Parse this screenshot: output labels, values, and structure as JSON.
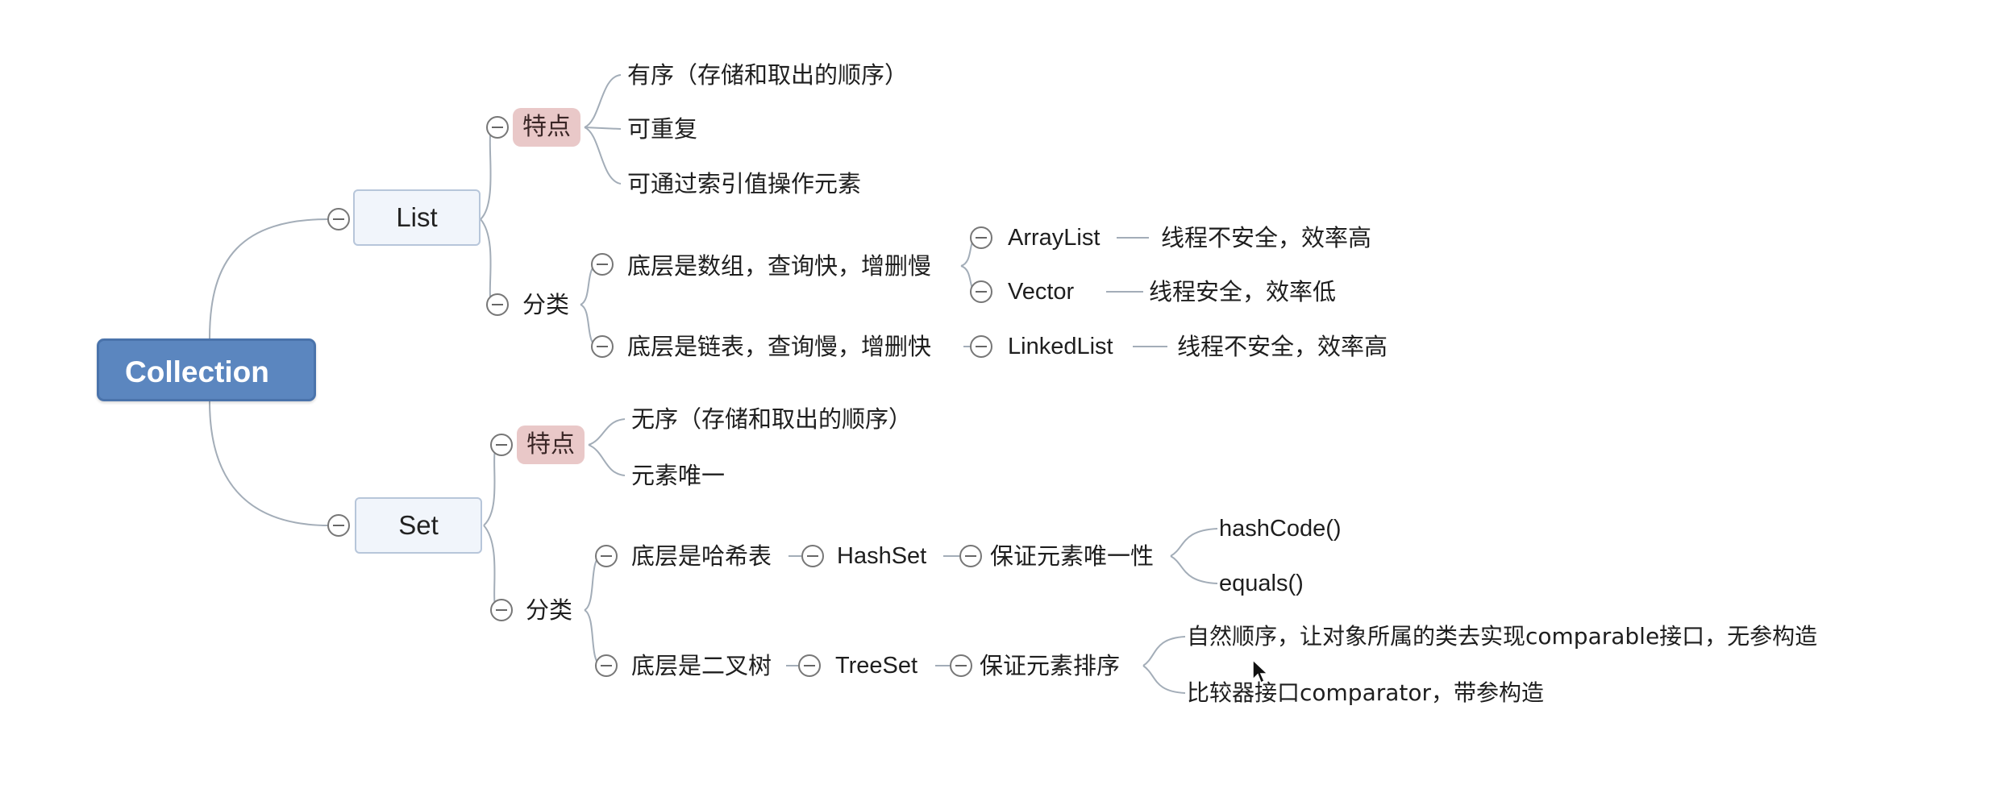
{
  "root": {
    "label": "Collection"
  },
  "list": {
    "label": "List",
    "features_label": "特点",
    "features": [
      "有序（存储和取出的顺序）",
      "可重复",
      "可通过索引值操作元素"
    ],
    "category_label": "分类",
    "array_based": {
      "label": "底层是数组，查询快，增删慢",
      "array_list": {
        "name": "ArrayList",
        "desc": "线程不安全，效率高"
      },
      "vector": {
        "name": "Vector",
        "desc": "线程安全，效率低"
      }
    },
    "linked_based": {
      "label": "底层是链表，查询慢，增删快",
      "linked_list": {
        "name": "LinkedList",
        "desc": "线程不安全，效率高"
      }
    }
  },
  "set": {
    "label": "Set",
    "features_label": "特点",
    "features": [
      "无序（存储和取出的顺序）",
      "元素唯一"
    ],
    "category_label": "分类",
    "hash_based": {
      "label": "底层是哈希表",
      "impl": "HashSet",
      "guarantee": "保证元素唯一性",
      "methods": [
        "hashCode()",
        "equals()"
      ]
    },
    "tree_based": {
      "label": "底层是二叉树",
      "impl": "TreeSet",
      "guarantee": "保证元素排序",
      "ways": [
        "自然顺序，让对象所属的类去实现comparable接口，无参构造",
        "比较器接口comparator，带参构造"
      ]
    }
  },
  "colors": {
    "root": "#5b86bf",
    "badge": "#e9c8c8",
    "line": "#9aa6b2"
  }
}
